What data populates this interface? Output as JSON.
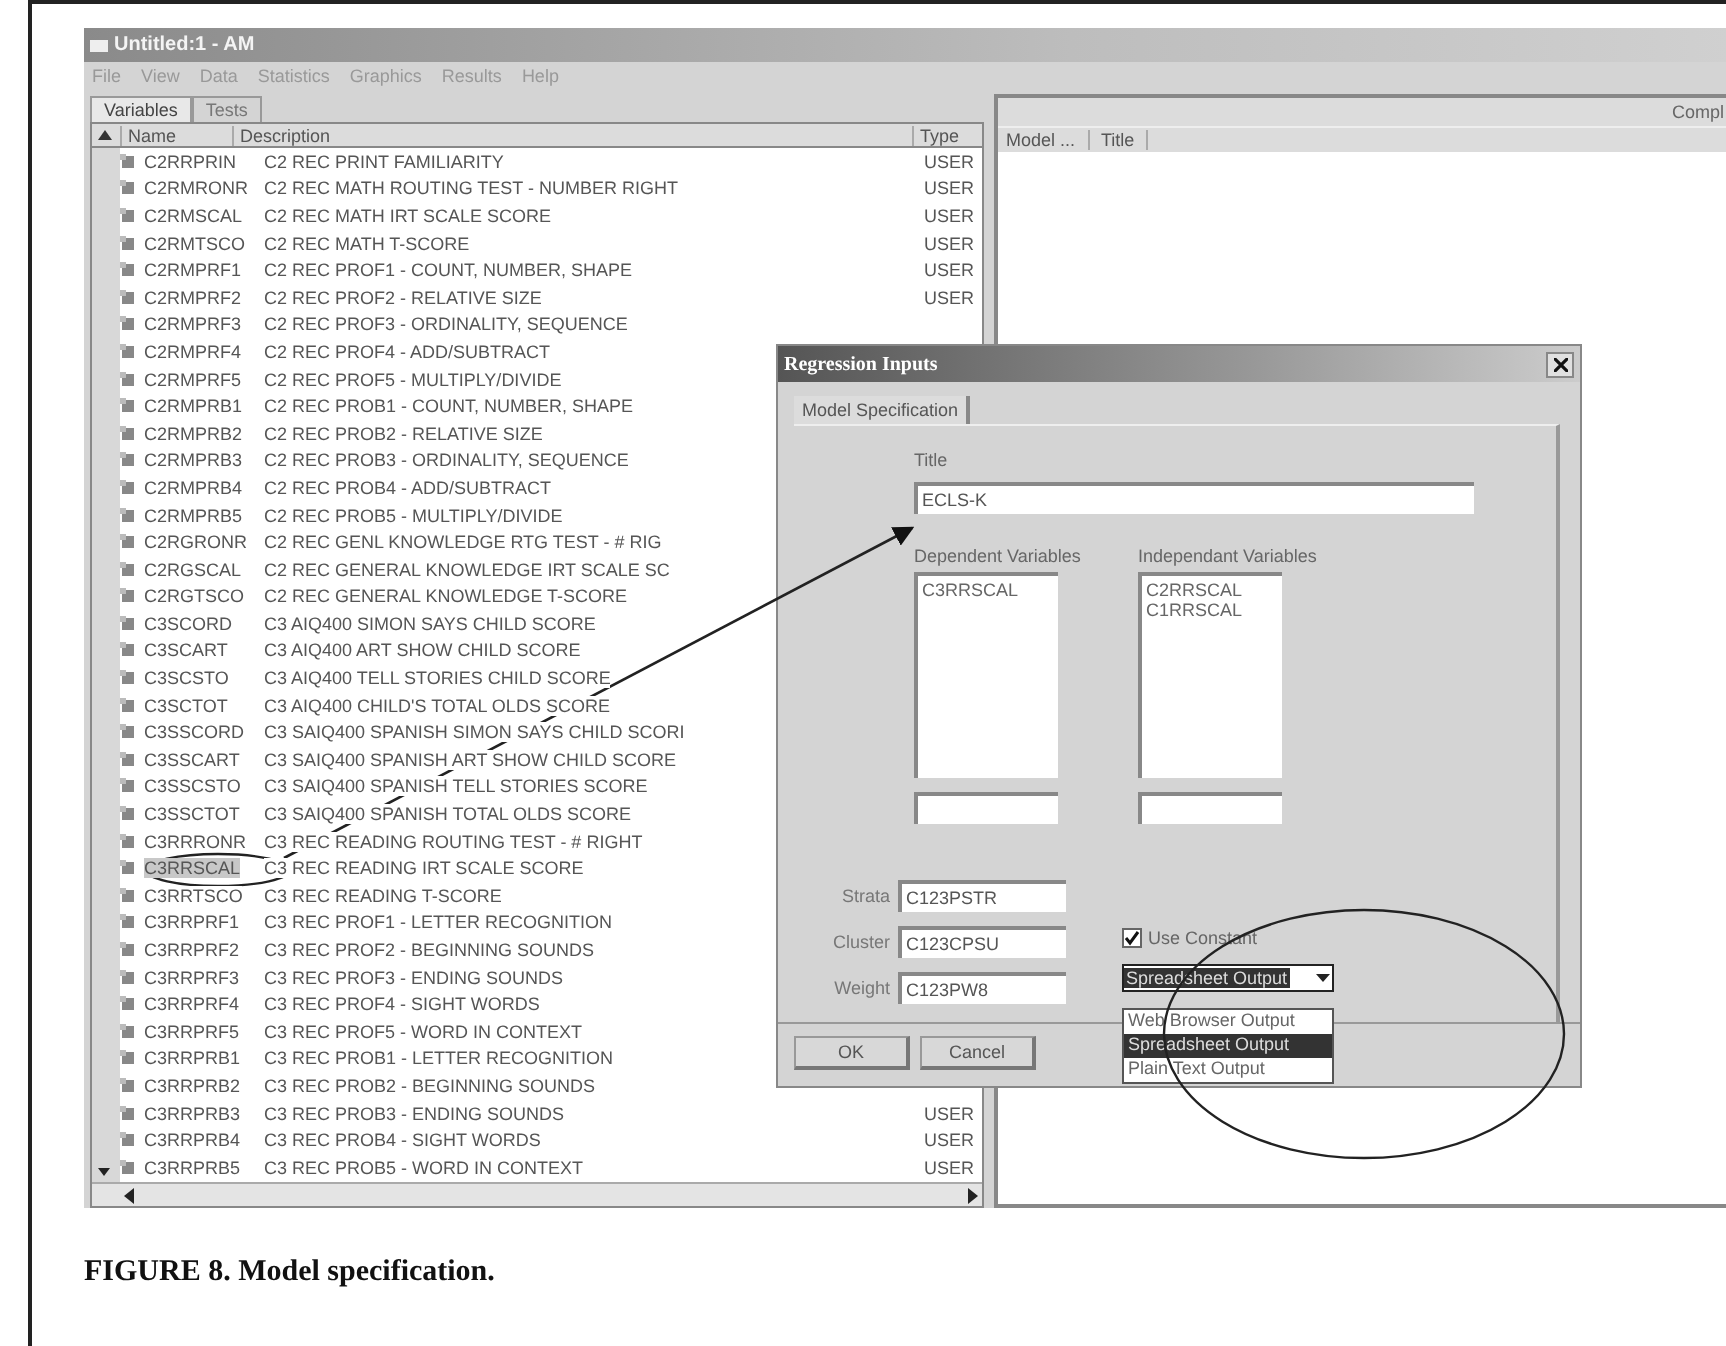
{
  "window": {
    "title": "Untitled:1 - AM"
  },
  "menu": [
    "File",
    "View",
    "Data",
    "Statistics",
    "Graphics",
    "Results",
    "Help"
  ],
  "left_tabs": [
    {
      "label": "Variables",
      "selected": true
    },
    {
      "label": "Tests",
      "selected": false
    }
  ],
  "variables_table": {
    "columns": [
      "Name",
      "Description",
      "Type"
    ],
    "rows": [
      {
        "name": "C2RRPRIN",
        "description": "C2 REC PRINT FAMILIARITY",
        "type": "USER",
        "selected": false
      },
      {
        "name": "C2RMRONR",
        "description": "C2 REC MATH ROUTING TEST - NUMBER RIGHT",
        "type": "USER",
        "selected": false
      },
      {
        "name": "C2RMSCAL",
        "description": "C2 REC MATH IRT SCALE SCORE",
        "type": "USER",
        "selected": false
      },
      {
        "name": "C2RMTSCO",
        "description": "C2 REC MATH T-SCORE",
        "type": "USER",
        "selected": false
      },
      {
        "name": "C2RMPRF1",
        "description": "C2 REC PROF1 - COUNT, NUMBER, SHAPE",
        "type": "USER",
        "selected": false
      },
      {
        "name": "C2RMPRF2",
        "description": "C2 REC PROF2 - RELATIVE SIZE",
        "type": "USER",
        "selected": false
      },
      {
        "name": "C2RMPRF3",
        "description": "C2 REC PROF3 - ORDINALITY, SEQUENCE",
        "selected": false
      },
      {
        "name": "C2RMPRF4",
        "description": "C2 REC PROF4 - ADD/SUBTRACT",
        "selected": false
      },
      {
        "name": "C2RMPRF5",
        "description": "C2 REC PROF5 - MULTIPLY/DIVIDE",
        "selected": false
      },
      {
        "name": "C2RMPRB1",
        "description": "C2 REC PROB1 - COUNT, NUMBER, SHAPE",
        "selected": false
      },
      {
        "name": "C2RMPRB2",
        "description": "C2 REC PROB2 - RELATIVE SIZE",
        "selected": false
      },
      {
        "name": "C2RMPRB3",
        "description": "C2 REC PROB3 - ORDINALITY, SEQUENCE",
        "selected": false
      },
      {
        "name": "C2RMPRB4",
        "description": "C2 REC PROB4 - ADD/SUBTRACT",
        "selected": false
      },
      {
        "name": "C2RMPRB5",
        "description": "C2 REC PROB5 - MULTIPLY/DIVIDE",
        "selected": false
      },
      {
        "name": "C2RGRONR",
        "description": "C2 REC GENL KNOWLEDGE RTG TEST - # RIG",
        "selected": false
      },
      {
        "name": "C2RGSCAL",
        "description": "C2 REC GENERAL KNOWLEDGE IRT SCALE SC",
        "selected": false
      },
      {
        "name": "C2RGTSCO",
        "description": "C2 REC GENERAL KNOWLEDGE T-SCORE",
        "selected": false
      },
      {
        "name": "C3SCORD",
        "description": "C3 AIQ400 SIMON SAYS CHILD SCORE",
        "selected": false
      },
      {
        "name": "C3SCART",
        "description": "C3 AIQ400 ART SHOW CHILD SCORE",
        "selected": false
      },
      {
        "name": "C3SCSTO",
        "description": "C3 AIQ400 TELL STORIES CHILD SCORE",
        "selected": false
      },
      {
        "name": "C3SCTOT",
        "description": "C3 AIQ400 CHILD'S TOTAL OLDS SCORE",
        "selected": false
      },
      {
        "name": "C3SSCORD",
        "description": "C3 SAIQ400 SPANISH SIMON SAYS CHILD SCORI",
        "selected": false
      },
      {
        "name": "C3SSCART",
        "description": "C3 SAIQ400 SPANISH ART SHOW CHILD SCORE",
        "selected": false
      },
      {
        "name": "C3SSCSTO",
        "description": "C3 SAIQ400 SPANISH TELL STORIES SCORE",
        "selected": false
      },
      {
        "name": "C3SSCTOT",
        "description": "C3 SAIQ400 SPANISH TOTAL OLDS SCORE",
        "selected": false
      },
      {
        "name": "C3RRRONR",
        "description": "C3 REC READING ROUTING TEST - # RIGHT",
        "selected": false
      },
      {
        "name": "C3RRSCAL",
        "description": "C3 REC READING IRT SCALE SCORE",
        "selected": true
      },
      {
        "name": "C3RRTSCO",
        "description": "C3 REC READING T-SCORE",
        "selected": false
      },
      {
        "name": "C3RRPRF1",
        "description": "C3 REC PROF1 - LETTER RECOGNITION",
        "selected": false
      },
      {
        "name": "C3RRPRF2",
        "description": "C3 REC PROF2 - BEGINNING SOUNDS",
        "selected": false
      },
      {
        "name": "C3RRPRF3",
        "description": "C3 REC PROF3 - ENDING SOUNDS",
        "selected": false
      },
      {
        "name": "C3RRPRF4",
        "description": "C3 REC PROF4 - SIGHT WORDS",
        "selected": false
      },
      {
        "name": "C3RRPRF5",
        "description": "C3 REC PROF5 - WORD IN CONTEXT",
        "selected": false
      },
      {
        "name": "C3RRPRB1",
        "description": "C3 REC PROB1 - LETTER RECOGNITION",
        "selected": false
      },
      {
        "name": "C3RRPRB2",
        "description": "C3 REC PROB2 - BEGINNING SOUNDS",
        "selected": false
      },
      {
        "name": "C3RRPRB3",
        "description": "C3 REC PROB3 - ENDING SOUNDS",
        "type": "USER",
        "selected": false
      },
      {
        "name": "C3RRPRB4",
        "description": "C3 REC PROB4 - SIGHT WORDS",
        "type": "USER",
        "selected": false
      },
      {
        "name": "C3RRPRB5",
        "description": "C3 REC PROB5 - WORD IN CONTEXT",
        "type": "USER",
        "selected": false
      }
    ]
  },
  "results_panel": {
    "heading": "Compl",
    "columns": [
      "Model ...",
      "Title"
    ]
  },
  "dialog": {
    "title": "Regression Inputs",
    "tabs": [
      {
        "label": "Model Specification",
        "selected": true
      }
    ],
    "title_field": {
      "label": "Title",
      "value": "ECLS-K"
    },
    "dependent": {
      "label": "Dependent Variables",
      "items": [
        "C3RRSCAL"
      ]
    },
    "independent": {
      "label": "Independant Variables",
      "items": [
        "C2RRSCAL",
        "C1RRSCAL"
      ]
    },
    "fields": [
      {
        "label": "Strata",
        "value": "C123PSTR"
      },
      {
        "label": "Cluster",
        "value": "C123CPSU"
      },
      {
        "label": "Weight",
        "value": "C123PW8"
      }
    ],
    "use_constant": {
      "label": "Use Constant",
      "checked": true
    },
    "output_select": {
      "value": "Spreadsheet Output",
      "expanded": true,
      "options": [
        {
          "label": "Web Browser Output",
          "selected": false
        },
        {
          "label": "Spreadsheet Output",
          "selected": true
        },
        {
          "label": "Plain Text Output",
          "selected": false
        }
      ]
    },
    "buttons": [
      "OK",
      "Cancel"
    ]
  },
  "caption": "FIGURE 8. Model specification."
}
